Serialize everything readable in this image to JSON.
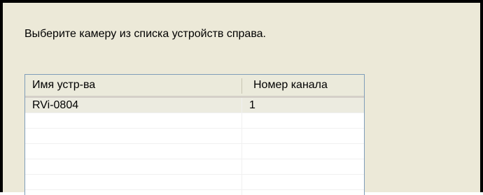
{
  "instruction": "Выберите камеру из списка устройств справа.",
  "devices_list": {
    "columns": {
      "name": "Имя устр-ва",
      "channel": "Номер канала"
    },
    "rows": [
      {
        "name": "RVi-0804",
        "channel": "1"
      },
      {
        "name": "",
        "channel": ""
      },
      {
        "name": "",
        "channel": ""
      },
      {
        "name": "",
        "channel": ""
      },
      {
        "name": "",
        "channel": ""
      },
      {
        "name": "",
        "channel": ""
      }
    ]
  }
}
